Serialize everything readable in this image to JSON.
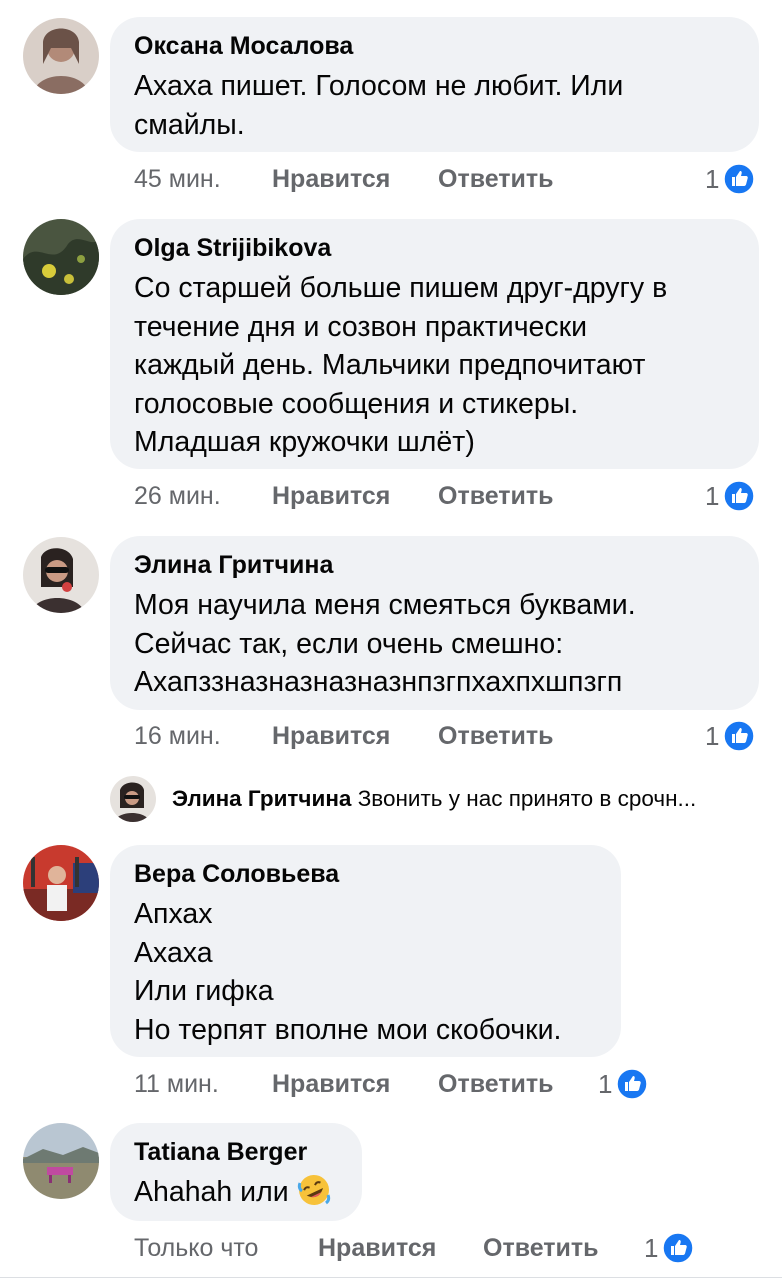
{
  "actions": {
    "like_label": "Нравится",
    "reply_label": "Ответить"
  },
  "colors": {
    "bubble": "#f0f2f5",
    "like_blue": "#1877f2",
    "meta_gray": "#65676b"
  },
  "comments": [
    {
      "author": "Оксана Мосалова",
      "text": "Ахаха пишет. Голосом не любит. Или\nсмайлы.",
      "time": "45 мин.",
      "reactions": "1",
      "avatar_icon": "user-avatar"
    },
    {
      "author": "Olga Strijibikova",
      "text": "Со старшей больше пишем друг-другу в\nтечение дня и созвон практически\nкаждый день. Мальчики предпочитают\nголосовые сообщения и стикеры.\nМладшая кружочки шлёт)",
      "time": "26 мин.",
      "reactions": "1",
      "avatar_icon": "user-avatar"
    },
    {
      "author": "Элина Гритчина",
      "text": "Моя научила меня смеяться буквами.\nСейчас так, если очень смешно:\nАхапззназназназназнпзгпхахпхшпзгп",
      "time": "16 мин.",
      "reactions": "1",
      "avatar_icon": "user-avatar"
    },
    {
      "author": "Вера Соловьева",
      "text": "Апхах\nАхаха\nИли гифка\nНо терпят вполне мои скобочки.",
      "time": "11 мин.",
      "reactions": "1",
      "avatar_icon": "user-avatar"
    },
    {
      "author": "Tatiana Berger",
      "text": "Ahahah или",
      "time": "Только что",
      "reactions": "1",
      "avatar_icon": "user-avatar",
      "emoji_icon": "rolling-laughing-emoji"
    }
  ],
  "reply_preview": {
    "author": "Элина Гритчина",
    "text": "Звонить у нас принято в срочн..."
  }
}
